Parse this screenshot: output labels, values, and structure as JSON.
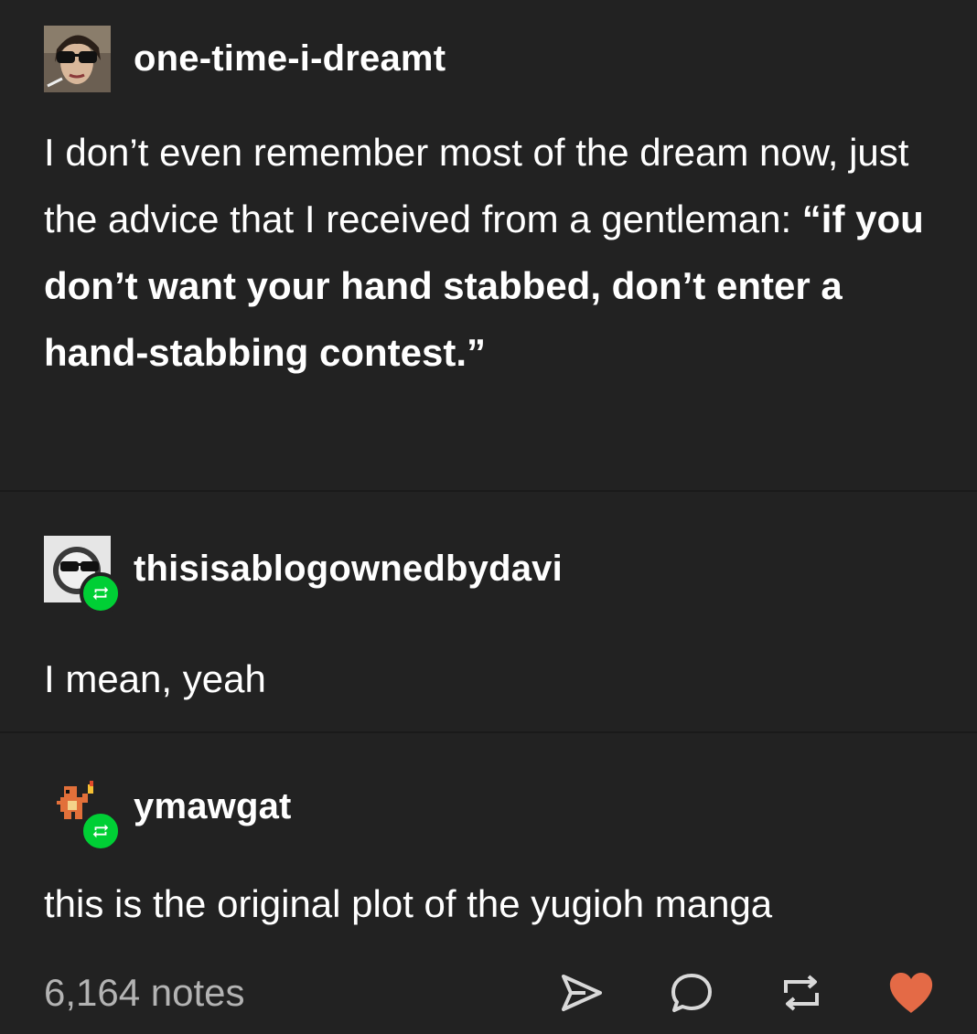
{
  "post": {
    "original": {
      "username": "one-time-i-dreamt",
      "text_plain": "I don’t even remember most of the dream now, just the advice that I received from a gentleman: ",
      "text_bold": "“if you don’t want your hand stabbed, don’t enter a hand-stabbing contest.”"
    },
    "reblogs": [
      {
        "username": "thisisablogownedbydavi",
        "text": "I mean, yeah"
      },
      {
        "username": "ymawgat",
        "text": "this is the original plot of the yugioh manga"
      }
    ],
    "footer": {
      "notes": "6,164 notes",
      "icons": [
        "share-icon",
        "reply-icon",
        "reblog-icon",
        "like-icon"
      ]
    }
  },
  "colors": {
    "background": "#222222",
    "text": "#ffffff",
    "muted": "#b3b3b3",
    "reblog_green": "#00cf35",
    "like_orange": "#e46a46"
  }
}
